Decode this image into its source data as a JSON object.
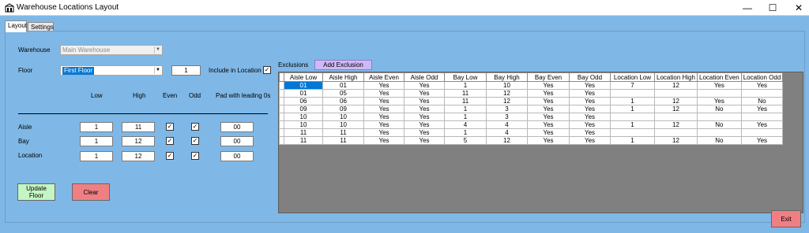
{
  "window": {
    "title": "Warehouse Locations Layout",
    "controls": {
      "minimize": "—",
      "maximize": "☐",
      "close": "✕"
    }
  },
  "tabs": [
    {
      "label": "Layout",
      "active": true
    },
    {
      "label": "Settings",
      "active": false
    }
  ],
  "form": {
    "warehouse_label": "Warehouse",
    "warehouse_value": "Main Warehouse",
    "floor_label": "Floor",
    "floor_value": "First Floor",
    "floor_number": "1",
    "include_in_location_label": "Include in Location",
    "include_in_location_checked": true,
    "col_headers": {
      "low": "Low",
      "high": "High",
      "even": "Even",
      "odd": "Odd",
      "pad": "Pad with leading 0s"
    },
    "rows": [
      {
        "label": "Aisle",
        "low": "1",
        "high": "11",
        "even": true,
        "odd": true,
        "pad": "00"
      },
      {
        "label": "Bay",
        "low": "1",
        "high": "12",
        "even": true,
        "odd": true,
        "pad": "00"
      },
      {
        "label": "Location",
        "low": "1",
        "high": "12",
        "even": true,
        "odd": true,
        "pad": "00"
      }
    ],
    "update_floor_label": "Update Floor",
    "clear_label": "Clear"
  },
  "exclusions": {
    "label": "Exclusions",
    "add_button_label": "Add Exclusion",
    "columns": [
      "Aisle Low",
      "Aisle High",
      "Aisle Even",
      "Aisle Odd",
      "Bay Low",
      "Bay High",
      "Bay Even",
      "Bay Odd",
      "Location Low",
      "Location High",
      "Location Even",
      "Location Odd"
    ],
    "rows": [
      [
        "01",
        "01",
        "Yes",
        "Yes",
        "1",
        "10",
        "Yes",
        "Yes",
        "7",
        "12",
        "Yes",
        "Yes"
      ],
      [
        "01",
        "05",
        "Yes",
        "Yes",
        "11",
        "12",
        "Yes",
        "Yes",
        "",
        "",
        "",
        ""
      ],
      [
        "06",
        "06",
        "Yes",
        "Yes",
        "11",
        "12",
        "Yes",
        "Yes",
        "1",
        "12",
        "Yes",
        "No"
      ],
      [
        "09",
        "09",
        "Yes",
        "Yes",
        "1",
        "3",
        "Yes",
        "Yes",
        "1",
        "12",
        "No",
        "Yes"
      ],
      [
        "10",
        "10",
        "Yes",
        "Yes",
        "1",
        "3",
        "Yes",
        "Yes",
        "",
        "",
        "",
        ""
      ],
      [
        "10",
        "10",
        "Yes",
        "Yes",
        "4",
        "4",
        "Yes",
        "Yes",
        "1",
        "12",
        "No",
        "Yes"
      ],
      [
        "11",
        "11",
        "Yes",
        "Yes",
        "1",
        "4",
        "Yes",
        "Yes",
        "",
        "",
        "",
        ""
      ],
      [
        "11",
        "11",
        "Yes",
        "Yes",
        "5",
        "12",
        "Yes",
        "Yes",
        "1",
        "12",
        "No",
        "Yes"
      ]
    ]
  },
  "exit_label": "Exit",
  "colors": {
    "background": "#7fb8e6",
    "update_button": "#c4f5c4",
    "clear_button": "#f07f83",
    "add_button": "#cdb9f5",
    "selection": "#0078d7"
  }
}
